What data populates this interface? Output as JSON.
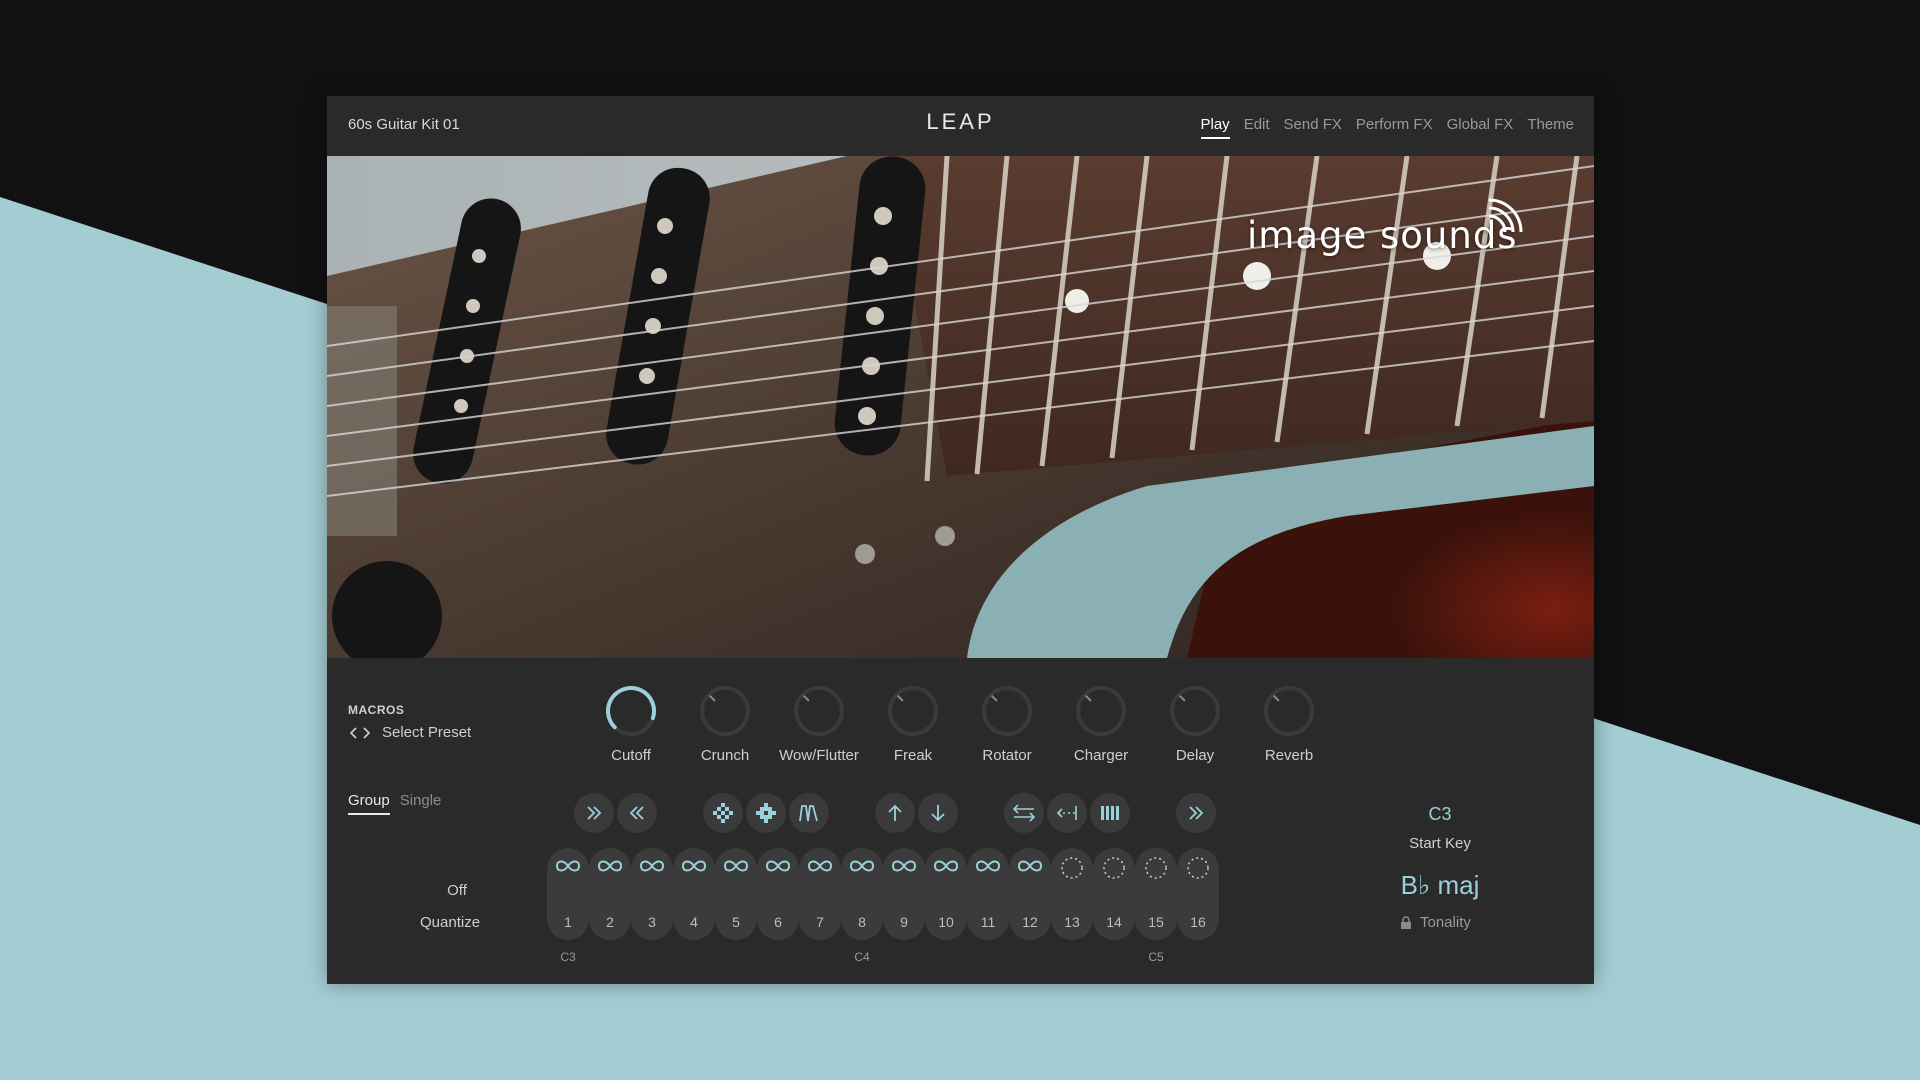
{
  "colors": {
    "accent": "#9ad0d9",
    "background_dark": "#111111",
    "background_teal": "#a4cdd3",
    "panel": "#2a2a2a"
  },
  "header": {
    "preset_name": "60s Guitar Kit 01",
    "logo": "LEAP",
    "nav": [
      "Play",
      "Edit",
      "Send FX",
      "Perform FX",
      "Global FX",
      "Theme"
    ],
    "active_nav": "Play"
  },
  "hero": {
    "brand_text": "image sounds",
    "icon": "sound-waves-icon"
  },
  "macros": {
    "title": "MACROS",
    "preset_select": "Select Preset",
    "knobs": [
      {
        "label": "Cutoff",
        "value": 0.9
      },
      {
        "label": "Crunch",
        "value": 0
      },
      {
        "label": "Wow/Flutter",
        "value": 0
      },
      {
        "label": "Freak",
        "value": 0
      },
      {
        "label": "Rotator",
        "value": 0
      },
      {
        "label": "Charger",
        "value": 0
      },
      {
        "label": "Delay",
        "value": 0
      },
      {
        "label": "Reverb",
        "value": 0
      }
    ]
  },
  "mode_tabs": [
    "Group",
    "Single"
  ],
  "active_mode": "Group",
  "quantize": {
    "value": "Off",
    "label": "Quantize"
  },
  "toolbar": {
    "buttons": [
      "double-chevron-right-icon",
      "double-chevron-left-icon",
      "shuffle-diamond-icon",
      "grid-diamond-icon",
      "peaks-icon",
      "arrow-up-icon",
      "arrow-down-icon",
      "swap-arrows-icon",
      "spread-arrows-icon",
      "bars-icon",
      "double-chevron-right-icon"
    ]
  },
  "pads": [
    {
      "num": "1",
      "state": "loop"
    },
    {
      "num": "2",
      "state": "loop"
    },
    {
      "num": "3",
      "state": "loop"
    },
    {
      "num": "4",
      "state": "loop"
    },
    {
      "num": "5",
      "state": "loop"
    },
    {
      "num": "6",
      "state": "loop"
    },
    {
      "num": "7",
      "state": "loop"
    },
    {
      "num": "8",
      "state": "loop"
    },
    {
      "num": "9",
      "state": "loop"
    },
    {
      "num": "10",
      "state": "loop"
    },
    {
      "num": "11",
      "state": "loop"
    },
    {
      "num": "12",
      "state": "loop"
    },
    {
      "num": "13",
      "state": "empty"
    },
    {
      "num": "14",
      "state": "empty"
    },
    {
      "num": "15",
      "state": "empty"
    },
    {
      "num": "16",
      "state": "empty"
    }
  ],
  "key_marks": [
    "C3",
    "C4",
    "C5"
  ],
  "start_key": {
    "value": "C3",
    "label": "Start Key"
  },
  "tonality": {
    "value": "B♭ maj",
    "label": "Tonality"
  }
}
